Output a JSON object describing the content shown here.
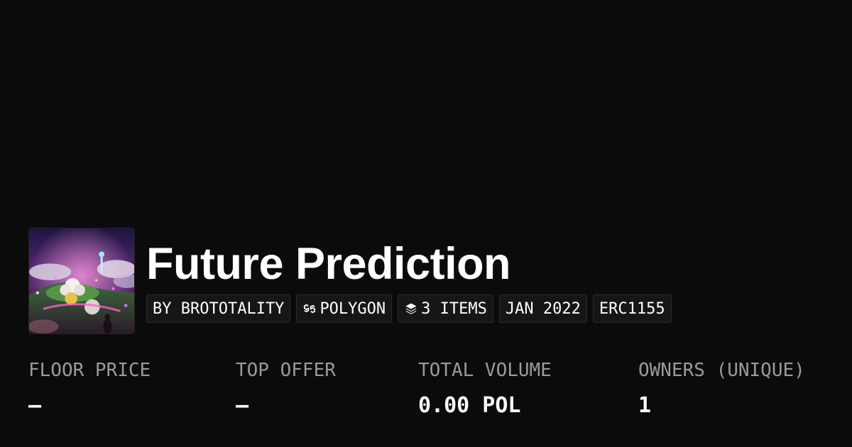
{
  "collection": {
    "title": "Future Prediction",
    "thumbnail_icon": "collection-artwork-image"
  },
  "chips": [
    {
      "label": "BY BROTOTALITY",
      "icon": ""
    },
    {
      "label": "POLYGON",
      "icon": "polygon-icon"
    },
    {
      "label": "3 ITEMS",
      "icon": "layers-icon"
    },
    {
      "label": "JAN 2022",
      "icon": ""
    },
    {
      "label": "ERC1155",
      "icon": ""
    }
  ],
  "stats": [
    {
      "label": "FLOOR PRICE",
      "value": "–"
    },
    {
      "label": "TOP OFFER",
      "value": "–"
    },
    {
      "label": "TOTAL VOLUME",
      "value": "0.00 POL"
    },
    {
      "label": "OWNERS (UNIQUE)",
      "value": "1"
    }
  ],
  "colors": {
    "background": "#0b0b0b",
    "chip_background": "#161616",
    "label_gray": "#9a9a9a",
    "text": "#ffffff"
  }
}
